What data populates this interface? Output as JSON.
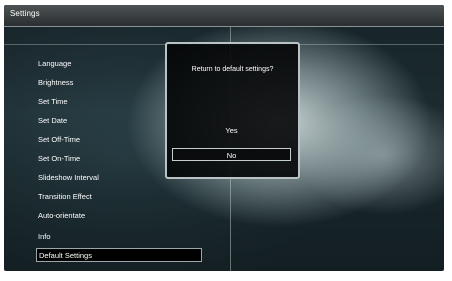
{
  "title_bar": {
    "title": "Settings"
  },
  "menu": {
    "items": [
      {
        "label": "Language"
      },
      {
        "label": "Brightness"
      },
      {
        "label": "Set Time"
      },
      {
        "label": "Set Date"
      },
      {
        "label": "Set Off-Time"
      },
      {
        "label": "Set On-Time"
      },
      {
        "label": "Slideshow Interval"
      },
      {
        "label": "Transition Effect"
      },
      {
        "label": "Auto-orientate"
      },
      {
        "label": "Info"
      },
      {
        "label": "Default Settings"
      }
    ],
    "selected_label": "Default Settings"
  },
  "dialog": {
    "message": "Return to default settings?",
    "options": [
      {
        "label": "Yes"
      },
      {
        "label": "No"
      }
    ],
    "selected_option": "No"
  }
}
